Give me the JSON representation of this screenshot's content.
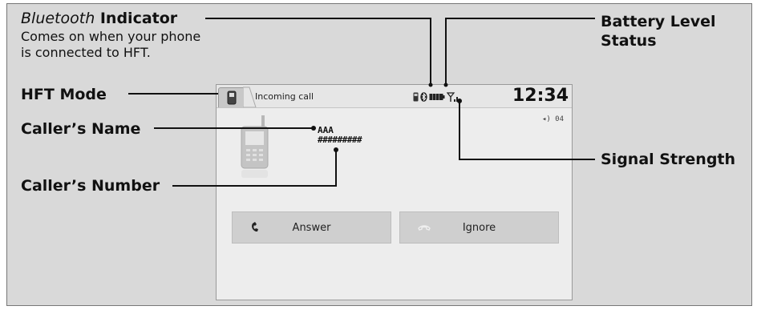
{
  "annotations": {
    "bluetooth_indicator_italic": "Bluetooth",
    "bluetooth_indicator_rest": " Indicator",
    "bluetooth_description_line1": "Comes on when your phone",
    "bluetooth_description_line2": "is connected to HFT.",
    "hft_mode": "HFT Mode",
    "callers_name": "Caller’s Name",
    "callers_number": "Caller’s Number",
    "battery_level_line1": "Battery Level",
    "battery_level_line2": "Status",
    "signal_strength": "Signal Strength"
  },
  "screen": {
    "status_text": "Incoming call",
    "clock": "12:34",
    "volume": "◂) 04",
    "caller_name": "AAA",
    "caller_number": "#########",
    "answer_label": "Answer",
    "ignore_label": "Ignore"
  },
  "icons": {
    "hft_mode": "phone-icon",
    "bluetooth": "bluetooth-icon",
    "battery": "battery-icon",
    "signal": "signal-strength-icon",
    "answer": "phone-answer-icon",
    "ignore": "phone-hangup-icon"
  },
  "colors": {
    "frame_background": "#d9d9d9",
    "screen_background": "#ededed",
    "button_background": "#cfcfcf"
  }
}
